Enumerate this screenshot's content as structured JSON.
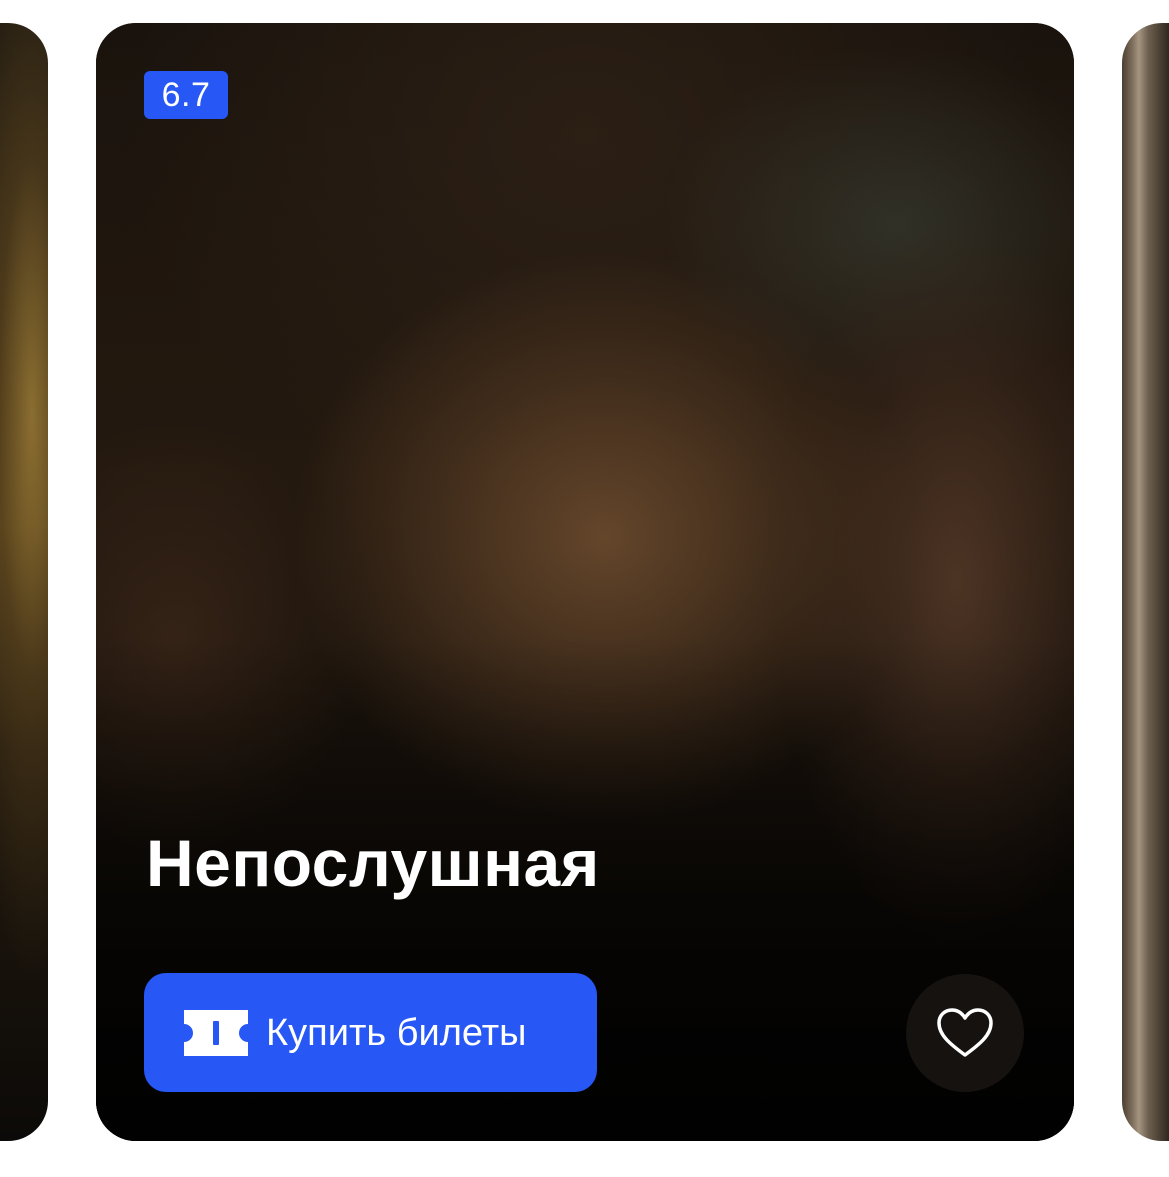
{
  "movie": {
    "rating": "6.7",
    "title": "Непослушная",
    "buy_button_label": "Купить билеты"
  },
  "icons": {
    "ticket": "ticket-icon",
    "favorite": "heart-outline-icon"
  },
  "colors": {
    "accent": "#2757f5",
    "text": "#ffffff",
    "favorite_bg": "#181412"
  }
}
